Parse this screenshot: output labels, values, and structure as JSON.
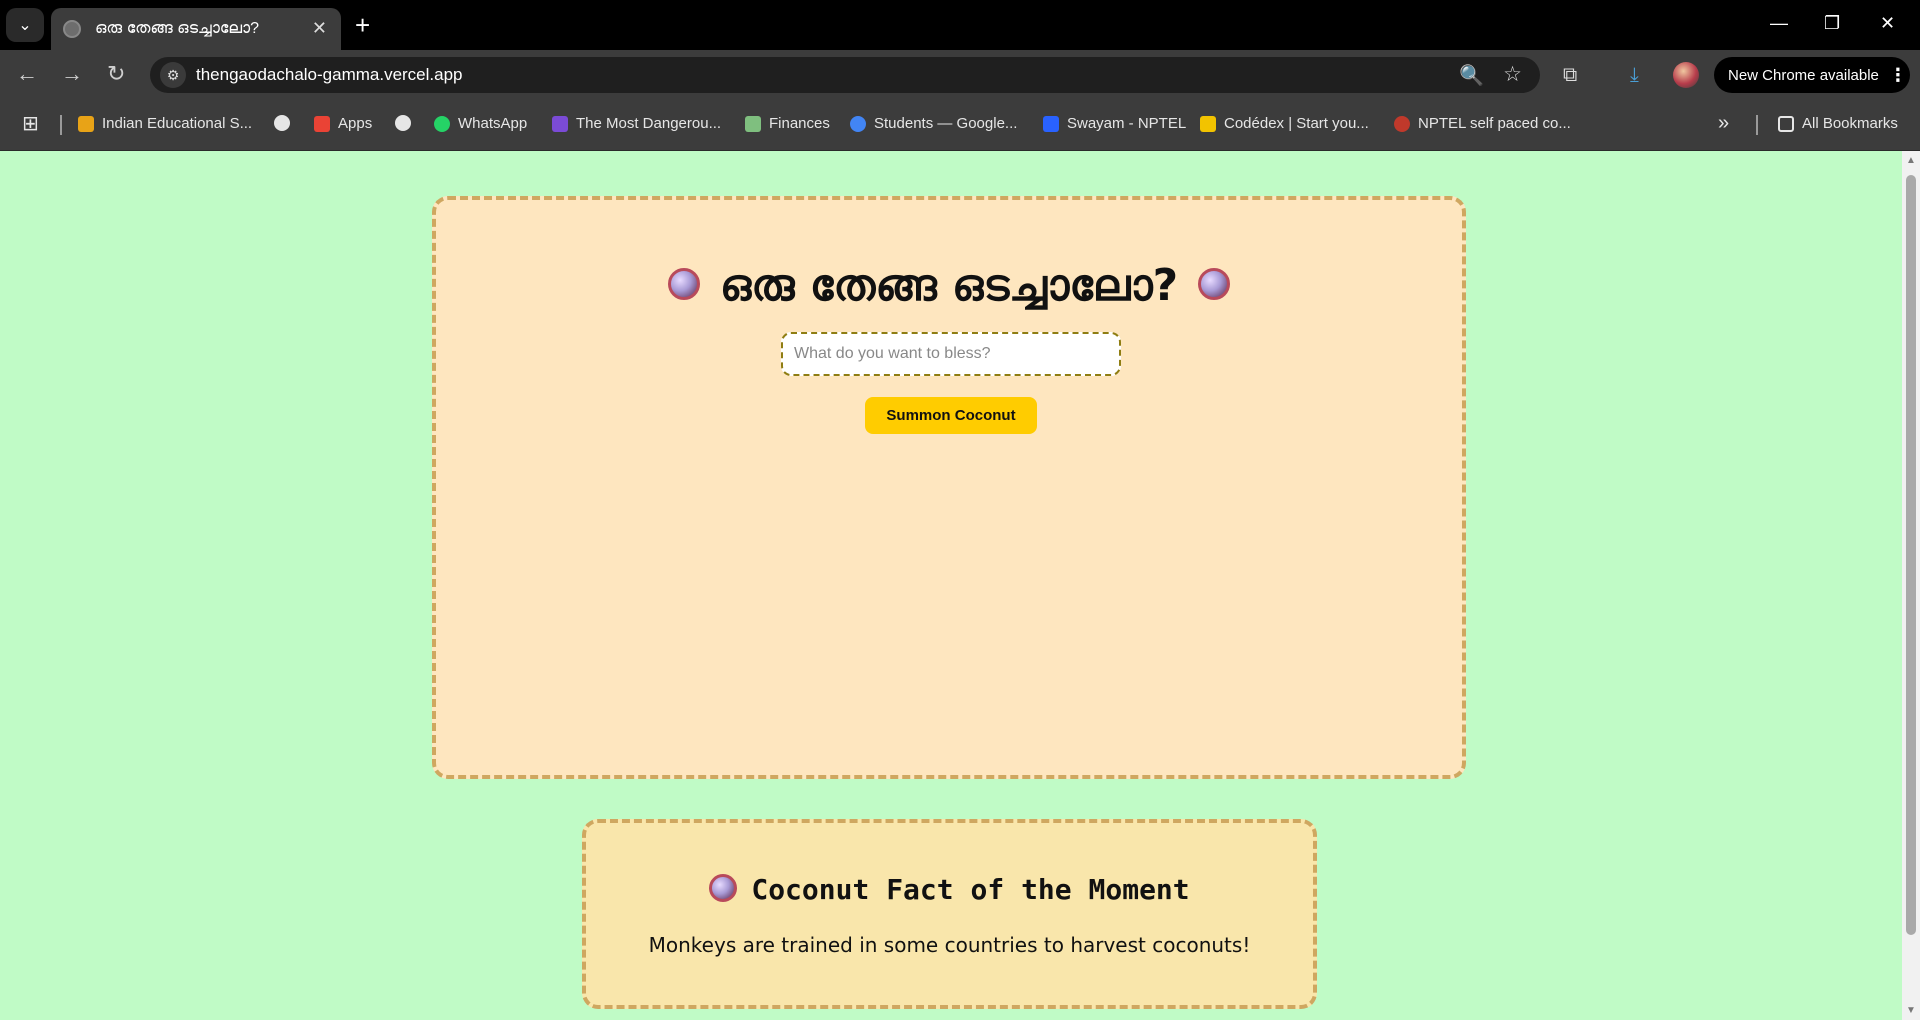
{
  "browser": {
    "tab": {
      "title": "ഒരു തേങ്ങ ഒടച്ചാലോ?",
      "close_glyph": "✕"
    },
    "new_tab_glyph": "+",
    "tab_list_glyph": "⌄",
    "window_controls": {
      "minimize": "—",
      "restore": "❐",
      "close": "✕"
    },
    "nav": {
      "back": "←",
      "forward": "→",
      "reload": "↻"
    },
    "omnibox": {
      "url": "thengaodachalo-gamma.vercel.app",
      "site_icon": "⚙",
      "zoom": "🔍",
      "star": "☆"
    },
    "toolbar_icons": {
      "extensions": "⧉",
      "downloads": "⤓"
    },
    "update_label": "New Chrome available",
    "menu_glyph": "⋮",
    "bookmarks": [
      {
        "label": "Indian Educational S...",
        "color": "#e8a317"
      },
      {
        "label": "",
        "color": "#e6e6e6"
      },
      {
        "label": "Apps",
        "color": "#ea4335"
      },
      {
        "label": "",
        "color": "#e6e6e6"
      },
      {
        "label": "WhatsApp",
        "color": "#25d366"
      },
      {
        "label": "The Most Dangerou...",
        "color": "#7b4bd6"
      },
      {
        "label": "Finances",
        "color": "#7fbf7f"
      },
      {
        "label": "Students — Google...",
        "color": "#4285f4"
      },
      {
        "label": "Swayam - NPTEL",
        "color": "#2962ff"
      },
      {
        "label": "Codédex | Start you...",
        "color": "#f2c300"
      },
      {
        "label": "NPTEL self paced co...",
        "color": "#c0392b"
      }
    ],
    "overflow_glyph": "»",
    "all_bookmarks": "All Bookmarks",
    "apps_glyph": "⊞"
  },
  "main": {
    "heading": "ഒരു തേങ്ങ ഒടച്ചാലോ?",
    "input_placeholder": "What do you want to bless?",
    "button_label": "Summon Coconut"
  },
  "fact": {
    "title": "Coconut Fact of the Moment",
    "text": "Monkeys are trained in some countries to harvest coconuts!"
  },
  "colors": {
    "page_bg": "#c0fbc6",
    "card_bg": "#fee6bf",
    "fact_bg": "#f9e6ab",
    "button_bg": "#ffcc00",
    "dashed_border": "#cfa760"
  }
}
